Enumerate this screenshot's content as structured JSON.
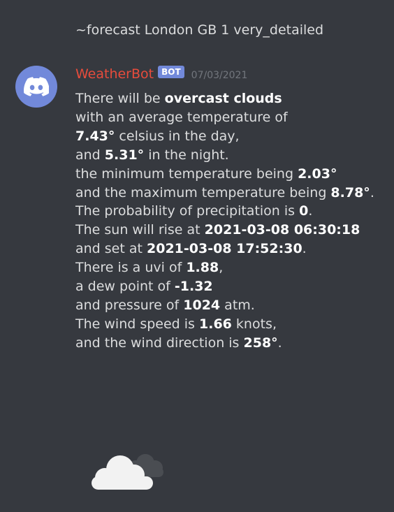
{
  "command": {
    "text": "~forecast London GB 1 very_detailed"
  },
  "message": {
    "avatar_icon": "discord-logo-icon",
    "username": "WeatherBot",
    "username_color": "#e74c3c",
    "bot_tag": "BOT",
    "timestamp": "07/03/2021",
    "lines": [
      {
        "pre": "There will be ",
        "bold": "overcast clouds",
        "post": ""
      },
      {
        "pre": "with an average temperature of",
        "bold": "",
        "post": ""
      },
      {
        "pre": "",
        "bold": "7.43°",
        "post": " celsius in the day,"
      },
      {
        "pre": "and ",
        "bold": "5.31°",
        "post": " in the night."
      },
      {
        "pre": "the minimum temperature being ",
        "bold": "2.03°",
        "post": ""
      },
      {
        "pre": "and the maximum temperature being ",
        "bold": "8.78°",
        "post": "."
      },
      {
        "pre": "The probability of precipitation is ",
        "bold": "0",
        "post": "."
      },
      {
        "pre": "The sun will rise at ",
        "bold": "2021-03-08 06:30:18",
        "post": ""
      },
      {
        "pre": "and set at ",
        "bold": "2021-03-08 17:52:30",
        "post": "."
      },
      {
        "pre": "There is a uvi of ",
        "bold": "1.88",
        "post": ","
      },
      {
        "pre": "a dew point of ",
        "bold": "-1.32",
        "post": ""
      },
      {
        "pre": "and pressure of ",
        "bold": "1024",
        "post": " atm."
      },
      {
        "pre": "The wind speed is ",
        "bold": "1.66",
        "post": " knots,"
      },
      {
        "pre": "and the wind direction is ",
        "bold": "258°",
        "post": "."
      }
    ],
    "weather_icon": "overcast-clouds-icon"
  },
  "colors": {
    "background": "#36393f",
    "text": "#dcddde",
    "bot_tag_bg": "#7289da",
    "timestamp": "#72767d"
  }
}
